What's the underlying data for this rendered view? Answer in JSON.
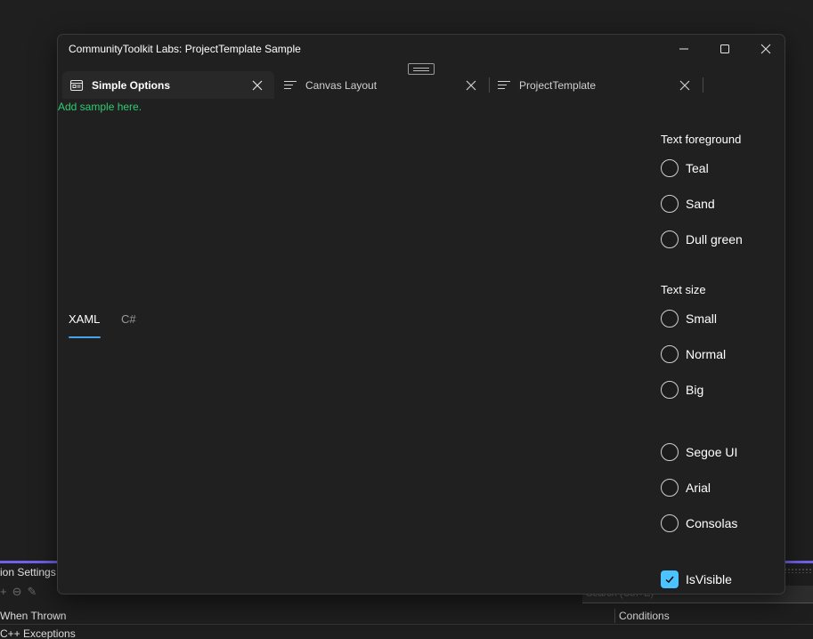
{
  "window": {
    "title": "CommunityToolkit Labs: ProjectTemplate Sample",
    "controls": {
      "minimize_icon": "minimize-icon",
      "maximize_icon": "maximize-icon",
      "close_icon": "close-icon"
    }
  },
  "tabs": [
    {
      "label": "Simple Options",
      "icon": "options-page-icon",
      "active": true
    },
    {
      "label": "Canvas Layout",
      "icon": "text-lines-icon",
      "active": false
    },
    {
      "label": "ProjectTemplate",
      "icon": "text-lines-icon",
      "active": false
    }
  ],
  "sample": {
    "placeholder_text": "Add sample here."
  },
  "code_tabs": [
    {
      "label": "XAML",
      "selected": true
    },
    {
      "label": "C#",
      "selected": false
    }
  ],
  "options": {
    "text_foreground": {
      "title": "Text foreground",
      "items": [
        "Teal",
        "Sand",
        "Dull green"
      ]
    },
    "text_size": {
      "title": "Text size",
      "items": [
        "Small",
        "Normal",
        "Big"
      ]
    },
    "font_family": {
      "title": "",
      "items": [
        "Segoe UI",
        "Arial",
        "Consolas"
      ]
    },
    "is_visible": {
      "label": "IsVisible",
      "checked": true
    }
  },
  "background_ide": {
    "panel_title": "ion Settings",
    "search_placeholder": "Search (Ctrl+E)",
    "column_when_thrown": "When Thrown",
    "column_conditions": "Conditions",
    "row_first": "C++ Exceptions"
  },
  "colors": {
    "accent_blue": "#4cc2ff",
    "sample_green": "#2ecc71",
    "ide_accent": "#7160e8",
    "window_bg": "#202020"
  }
}
